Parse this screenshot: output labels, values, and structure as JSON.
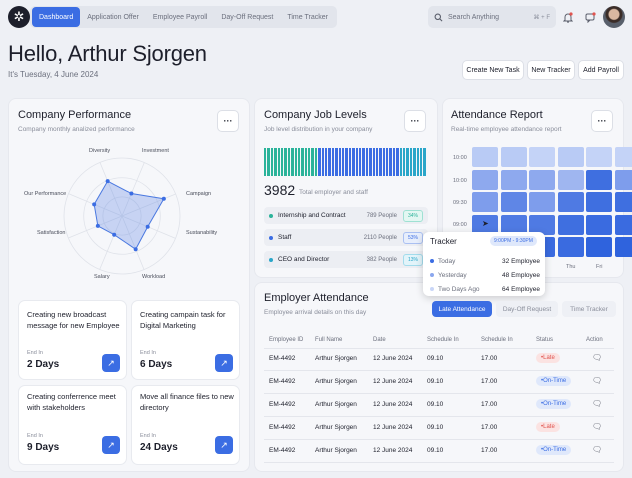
{
  "nav": {
    "tabs": [
      "Dashboard",
      "Application Offer",
      "Employee Payroll",
      "Day-Off Request",
      "Time Tracker"
    ],
    "search_placeholder": "Search Anything",
    "search_shortcut": "⌘ + F"
  },
  "hero": {
    "greeting": "Hello, Arthur Sjorgen",
    "date": "It's Tuesday, 4 June 2024",
    "buttons": [
      "Create New Task",
      "New Tracker",
      "Add Payroll"
    ]
  },
  "performance": {
    "title": "Company Performance",
    "subtitle": "Company monthly analized performance",
    "menu": "···",
    "axes": [
      "Diversity",
      "Investment",
      "Campaign",
      "Sustanability",
      "Workload",
      "Salary",
      "Satisfaction",
      "Our Performance"
    ],
    "values": [
      0.65,
      0.42,
      0.78,
      0.48,
      0.62,
      0.35,
      0.45,
      0.52
    ]
  },
  "tasks": [
    {
      "title": "Creating new broadcast message for new Employee",
      "ends_label": "End In",
      "days": "2 Days"
    },
    {
      "title": "Creating campain task for Digital Marketing",
      "ends_label": "End In",
      "days": "6 Days"
    },
    {
      "title": "Creating conferrence meet with stakeholders",
      "ends_label": "End In",
      "days": "9 Days"
    },
    {
      "title": "Move all finance files to new directory",
      "ends_label": "End In",
      "days": "24 Days"
    }
  ],
  "job_levels": {
    "title": "Company Job Levels",
    "subtitle": "Job level distribution in your company",
    "menu": "···",
    "total": "3982",
    "total_label": "Total employer and staff",
    "rows": [
      {
        "name": "Internship and Contract",
        "count": "789 People",
        "pct": "34%",
        "color": "#2bb39a"
      },
      {
        "name": "Staff",
        "count": "2110 People",
        "pct": "53%",
        "color": "#3b6de3"
      },
      {
        "name": "CEO and Director",
        "count": "382 People",
        "pct": "13%",
        "color": "#2aa6c9"
      }
    ]
  },
  "attendance_report": {
    "title": "Attendance Report",
    "subtitle": "Real-time employee attendance report",
    "menu": "···",
    "y_labels": [
      "10:00",
      "10:00",
      "09:30",
      "09:00"
    ],
    "x_labels": [
      "Thu",
      "Fri"
    ],
    "tracker": {
      "title": "Tracker",
      "range": "9:00PM - 9:30PM",
      "rows": [
        {
          "label": "Today",
          "value": "32 Employee",
          "color": "#3b6de3"
        },
        {
          "label": "Yesterday",
          "value": "48 Employee",
          "color": "#8ba7ee"
        },
        {
          "label": "Two Days Ago",
          "value": "64 Employee",
          "color": "#c9d6f7"
        }
      ]
    }
  },
  "employer_attendance": {
    "title": "Employer Attendance",
    "subtitle": "Employee arrival details on this day",
    "tabs": [
      "Late Attendance",
      "Day-Off Request",
      "Time Tracker"
    ],
    "headers": [
      "Employee ID",
      "Full Name",
      "Date",
      "Schedule In",
      "Schedule In",
      "Status",
      "Action"
    ],
    "rows": [
      {
        "id": "EM-4492",
        "name": "Arthur Sjorgen",
        "date": "12 June 2024",
        "in1": "09.10",
        "in2": "17.00",
        "status": "Late"
      },
      {
        "id": "EM-4492",
        "name": "Arthur Sjorgen",
        "date": "12 June 2024",
        "in1": "09.10",
        "in2": "17.00",
        "status": "On-Time"
      },
      {
        "id": "EM-4492",
        "name": "Arthur Sjorgen",
        "date": "12 June 2024",
        "in1": "09.10",
        "in2": "17.00",
        "status": "On-Time"
      },
      {
        "id": "EM-4492",
        "name": "Arthur Sjorgen",
        "date": "12 June 2024",
        "in1": "09.10",
        "in2": "17.00",
        "status": "Late"
      },
      {
        "id": "EM-4492",
        "name": "Arthur Sjorgen",
        "date": "12 June 2024",
        "in1": "09.10",
        "in2": "17.00",
        "status": "On-Time"
      }
    ]
  },
  "colors": {
    "accent": "#3b6de3",
    "late": "#e0544f",
    "ontime": "#3b6de3"
  }
}
